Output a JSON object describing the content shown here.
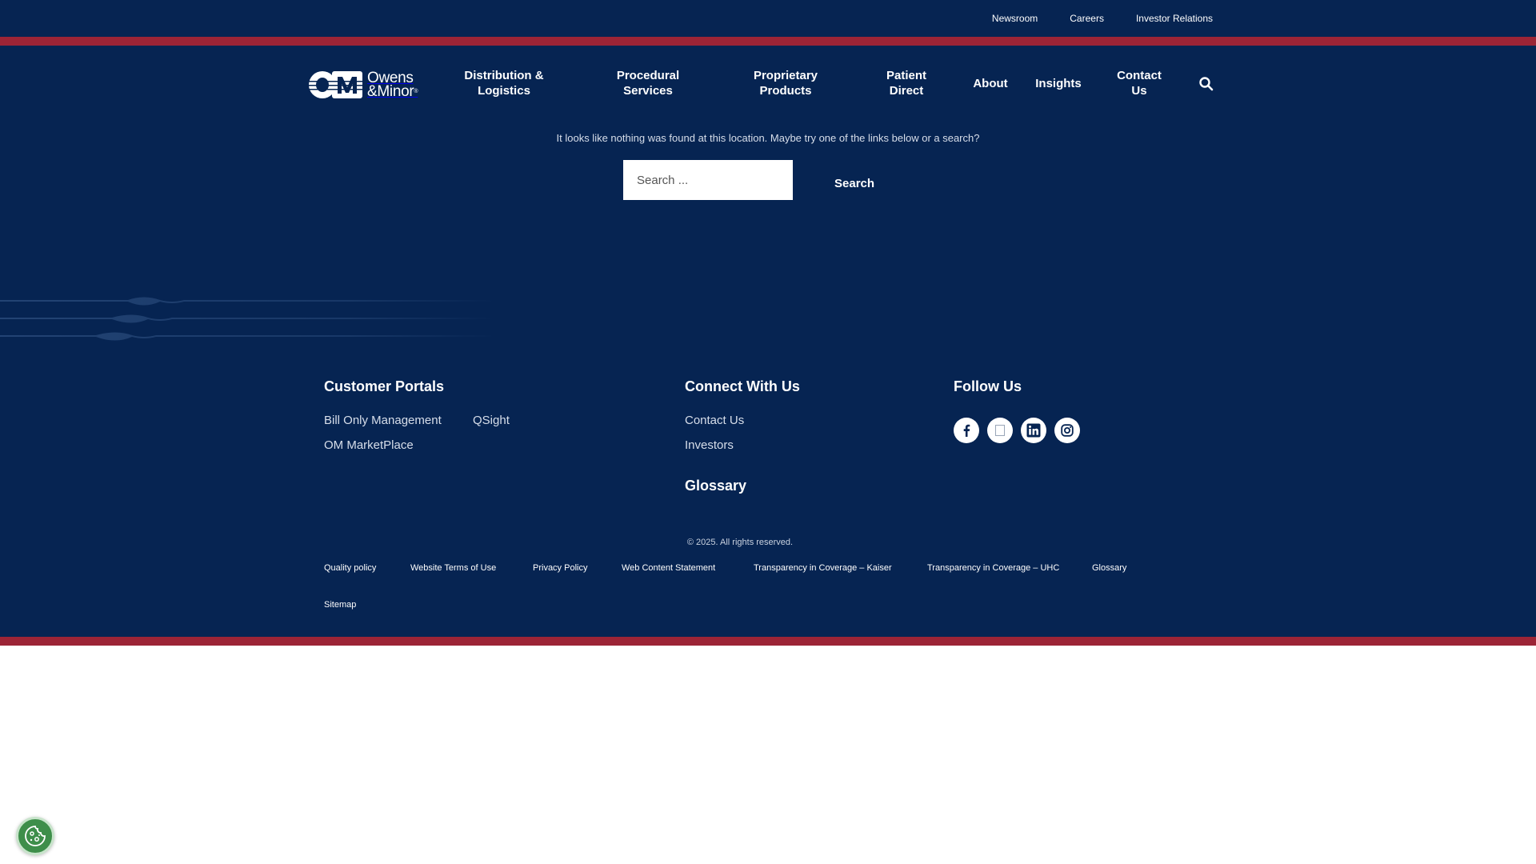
{
  "topbar": {
    "links": [
      "Newsroom",
      "Careers",
      "Investor Relations"
    ]
  },
  "logo": {
    "mark": "OM",
    "line1": "Owens",
    "line2": "&Minor",
    "reg": "®"
  },
  "nav": {
    "distribution": "Distribution & Logistics",
    "procedural": "Procedural Services",
    "proprietary": "Proprietary Products",
    "patient": "Patient Direct",
    "about": "About",
    "insights": "Insights",
    "contact": "Contact Us",
    "search_icon": "search-icon"
  },
  "notfound": {
    "message": "It looks like nothing was found at this location. Maybe try one of the links below or a search?",
    "placeholder": "Search ...",
    "button": "Search"
  },
  "footer": {
    "portals": {
      "heading": "Customer Portals",
      "links": [
        "Bill Only Management",
        "QSight",
        "OM MarketPlace"
      ]
    },
    "connect": {
      "heading": "Connect With Us",
      "links": [
        "Contact Us",
        "Investors"
      ]
    },
    "glossary": {
      "heading": "Glossary"
    },
    "follow": {
      "heading": "Follow Us",
      "icons": [
        "facebook-icon",
        "x-icon",
        "linkedin-icon",
        "instagram-icon"
      ]
    },
    "copyright": "© 2025. All rights reserved.",
    "legal": [
      "Quality policy",
      "Website Terms of Use",
      "Privacy Policy",
      "Web Content Statement",
      "Transparency in Coverage – Kaiser",
      "Transparency in Coverage – UHC",
      "Glossary"
    ],
    "sitemap": "Sitemap"
  },
  "colors": {
    "navy": "#062452",
    "red": "#9c2436",
    "cookie_green": "#3e8e4a"
  },
  "cookie": {
    "icon": "cookie-icon"
  }
}
